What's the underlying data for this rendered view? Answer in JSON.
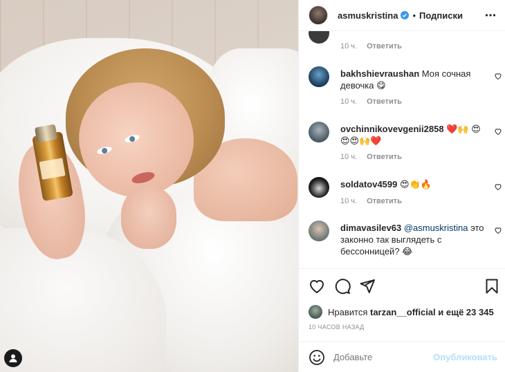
{
  "post": {
    "username": "asmuskristina",
    "follow_label": "Подписки",
    "dot": "•"
  },
  "comments": [
    {
      "user": "",
      "text": "",
      "time": "10 ч.",
      "reply": "Ответить"
    },
    {
      "user": "bakhshievraushan",
      "text": "Моя сочная девочка 😋",
      "time": "10 ч.",
      "reply": "Ответить"
    },
    {
      "user": "ovchinnikovevgenii2858",
      "text": "❤️🙌 😍😍😍🙌❤️",
      "time": "10 ч.",
      "reply": "Ответить"
    },
    {
      "user": "soldatov4599",
      "text": "😍👏🔥",
      "time": "10 ч.",
      "reply": "Ответить"
    },
    {
      "user": "dimavasilev63",
      "mention": "@asmuskristina",
      "text": "это законно так выглядеть с бессонницей? 😂",
      "time": "",
      "reply": ""
    }
  ],
  "likes": {
    "prefix": "Нравится",
    "user": "tarzan__official",
    "suffix": "и ещё 23 345"
  },
  "time_ago": "10 ЧАСОВ НАЗАД",
  "add_comment": {
    "placeholder": "Добавьте",
    "publish_label": "Опубликовать"
  },
  "colors": {
    "accent_link": "#00376b",
    "publish_disabled": "#b2dffc",
    "muted": "#8e8e8e",
    "verified": "#3897f0"
  }
}
